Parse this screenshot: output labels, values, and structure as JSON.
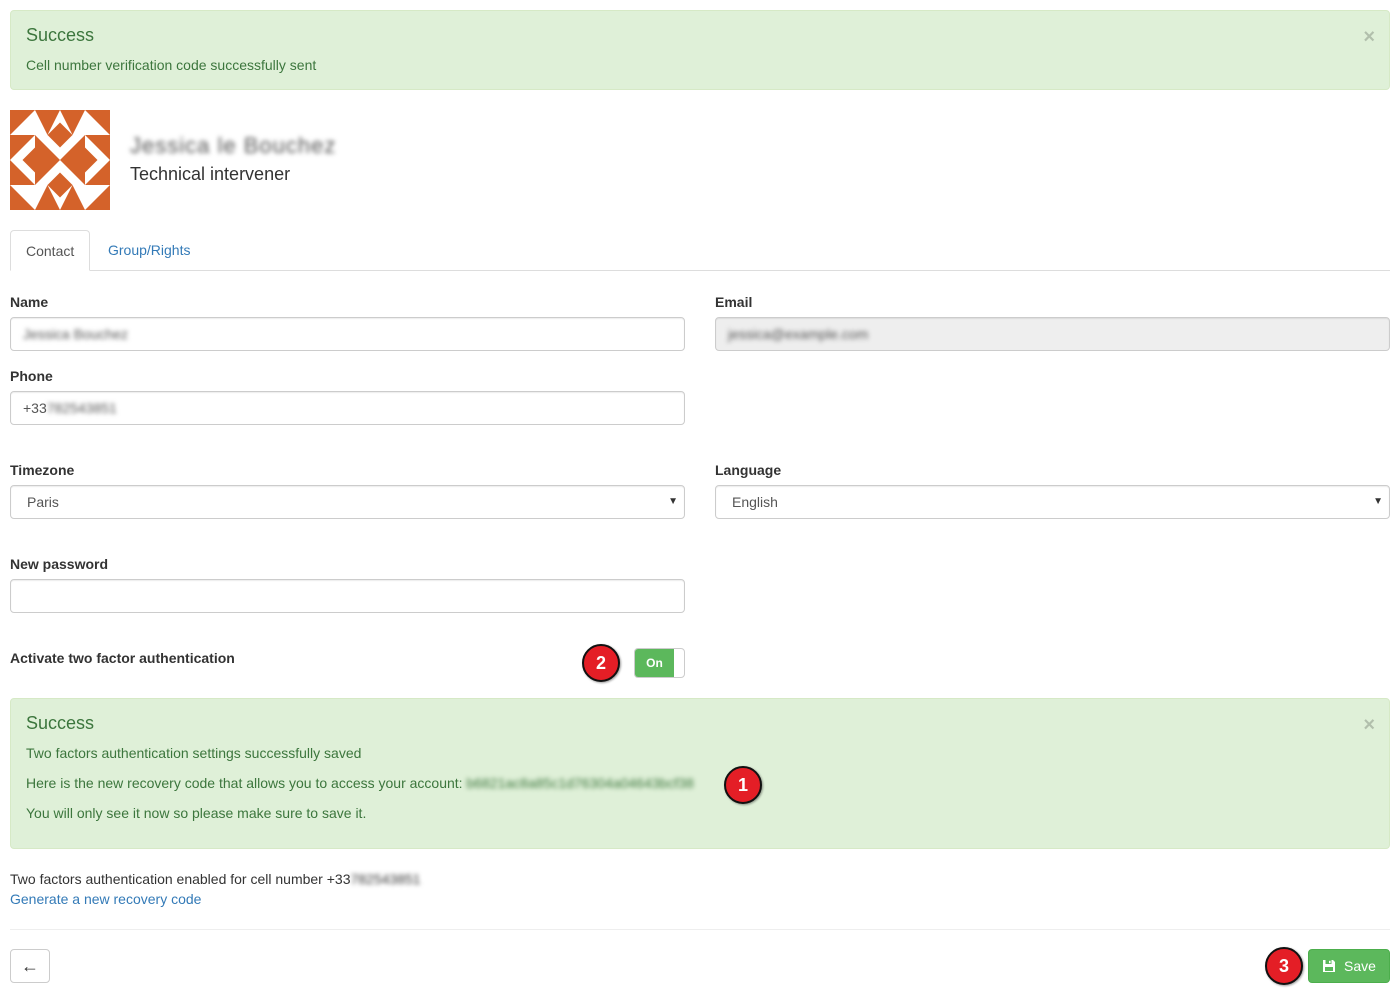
{
  "alert_top": {
    "title": "Success",
    "message": "Cell number verification code successfully sent",
    "close": "×"
  },
  "profile": {
    "display_name": "Jessica le Bouchez",
    "role": "Technical intervener"
  },
  "tabs": [
    {
      "label": "Contact",
      "active": true
    },
    {
      "label": "Group/Rights",
      "active": false
    }
  ],
  "form": {
    "name_label": "Name",
    "name_value": "Jessica Bouchez",
    "email_label": "Email",
    "email_value": "jessica@example.com",
    "phone_label": "Phone",
    "phone_prefix": "+33",
    "phone_rest": "782543851",
    "timezone_label": "Timezone",
    "timezone_value": "Paris",
    "language_label": "Language",
    "language_value": "English",
    "password_label": "New password",
    "password_value": "",
    "twofa_label": "Activate two factor authentication",
    "twofa_toggle": "On"
  },
  "alert_bottom": {
    "title": "Success",
    "line1": "Two factors authentication settings successfully saved",
    "line2": "Here is the new recovery code that allows you to access your account: ",
    "recovery_code": "b6821ac8a85c1d76304a04643bcf38",
    "line3": "You will only see it now so please make sure to save it.",
    "close": "×"
  },
  "info": {
    "enabled_text": "Two factors authentication enabled for cell number +33",
    "enabled_number": "782543851",
    "generate_link": "Generate a new recovery code"
  },
  "footer": {
    "back_icon": "←",
    "save_label": "Save"
  },
  "markers": [
    "1",
    "2",
    "3"
  ],
  "colors": {
    "success_bg": "#dff0d8",
    "success_text": "#3c763d",
    "save_green": "#5cb85c",
    "link_blue": "#337ab7",
    "marker_red": "#e41e26",
    "avatar_orange": "#d4622a"
  }
}
